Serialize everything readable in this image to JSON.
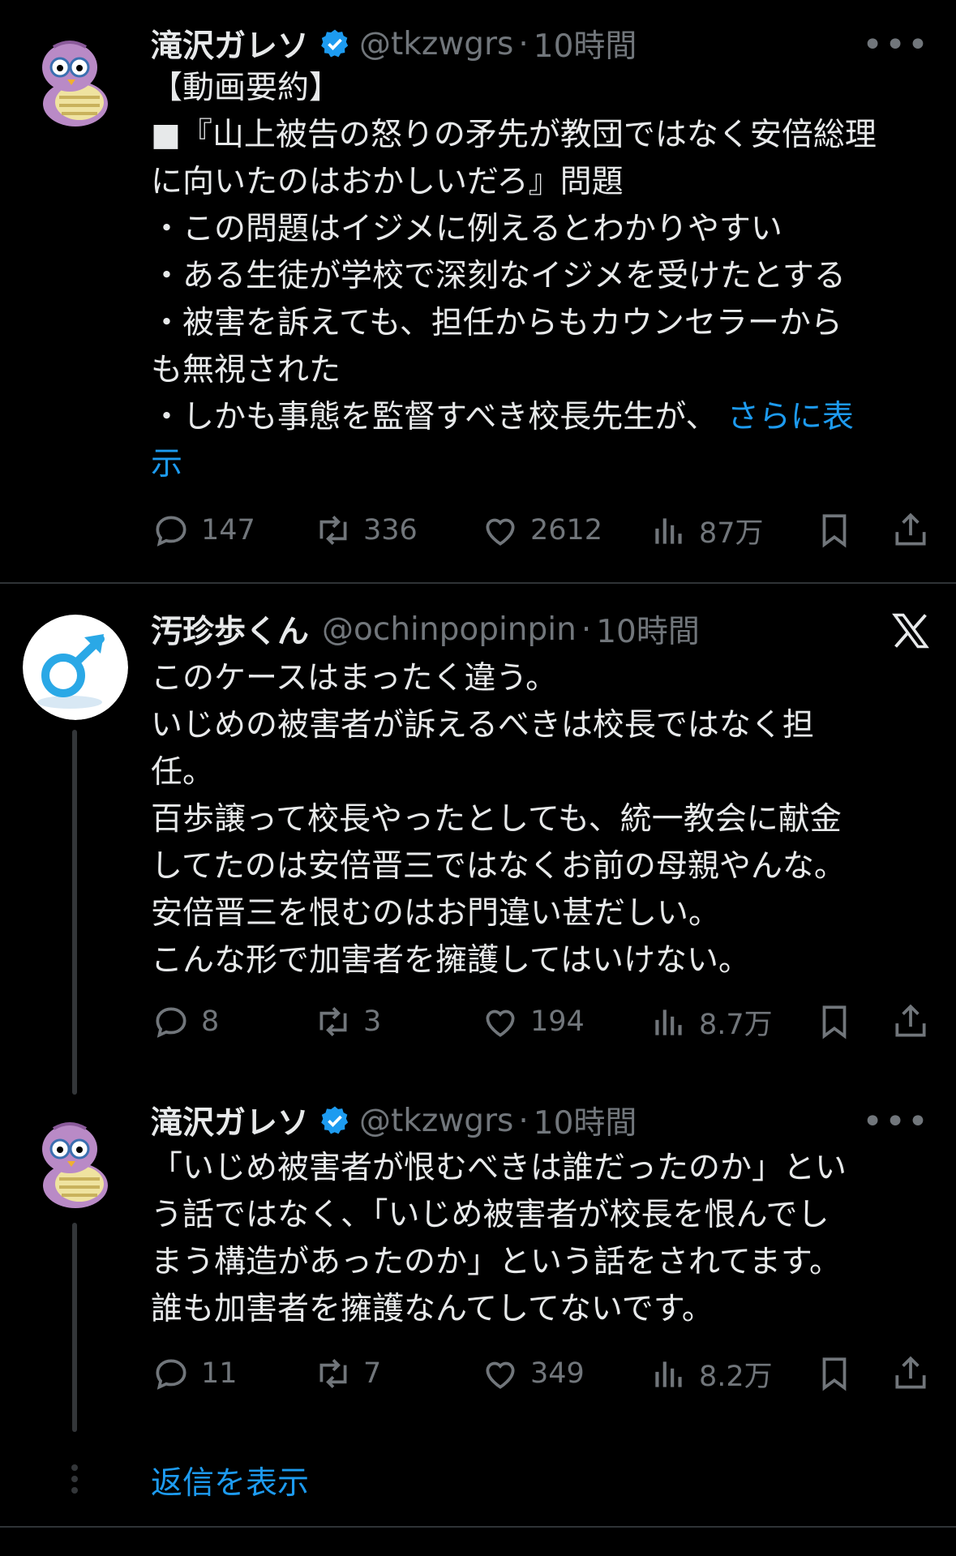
{
  "tweets": [
    {
      "author": "滝沢ガレソ",
      "handle": "@tkzwgrs",
      "separator": "·",
      "time": "10時間",
      "verified": true,
      "more_label": "•••",
      "lines": [
        "【動画要約】",
        "■『山上被告の怒りの矛先が教団ではなく安倍総理",
        "に向いたのはおかしいだろ』問題",
        "・この問題はイジメに例えるとわかりやすい",
        "・ある生徒が学校で深刻なイジメを受けたとする",
        "・被害を訴えても、担任からもカウンセラーから",
        "も無視された",
        "・しかも事態を監督すべき校長先生が、",
        "示"
      ],
      "show_more": "さらに表",
      "stats": {
        "replies": "147",
        "retweets": "336",
        "likes": "2612",
        "views": "87万"
      }
    },
    {
      "author": "汚珍歩くん",
      "handle": "@ochinpopinpin",
      "separator": "·",
      "time": "10時間",
      "verified": false,
      "lines": [
        "このケースはまったく違う。",
        "いじめの被害者が訴えるべきは校長ではなく担",
        "任。",
        "百歩譲って校長やったとしても、統一教会に献金",
        "してたのは安倍晋三ではなくお前の母親やんな。",
        "安倍晋三を恨むのはお門違い甚だしい。",
        "こんな形で加害者を擁護してはいけない。"
      ],
      "stats": {
        "replies": "8",
        "retweets": "3",
        "likes": "194",
        "views": "8.7万"
      }
    },
    {
      "author": "滝沢ガレソ",
      "handle": "@tkzwgrs",
      "separator": "·",
      "time": "10時間",
      "verified": true,
      "more_label": "•••",
      "lines": [
        "「いじめ被害者が恨むべきは誰だったのか」とい",
        "う話ではなく、「いじめ被害者が校長を恨んでし",
        "まう構造があったのか」という話をされてます。",
        "誰も加害者を擁護なんてしてないです。"
      ],
      "stats": {
        "replies": "11",
        "retweets": "7",
        "likes": "349",
        "views": "8.2万"
      }
    }
  ],
  "show_replies": "返信を表示",
  "colors": {
    "background": "#000000",
    "text": "#e7e9ea",
    "muted": "#71767b",
    "accent": "#1d9bf0",
    "divider": "#2f3336"
  }
}
